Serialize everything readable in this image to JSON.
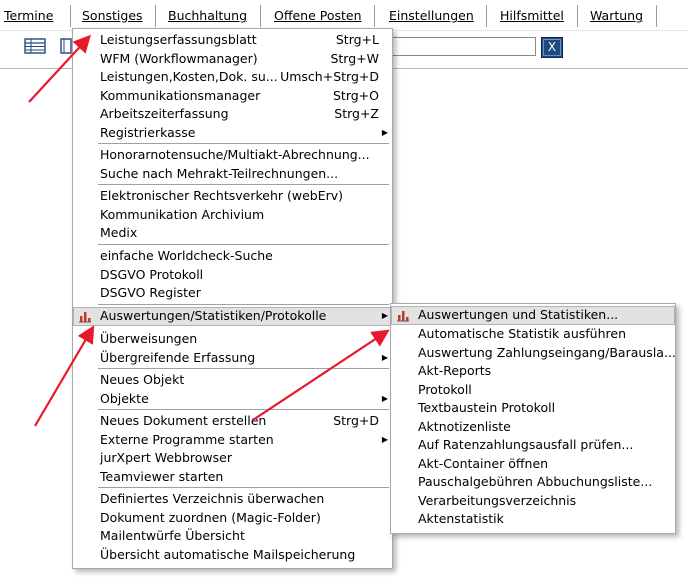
{
  "menubar": {
    "items": [
      {
        "label": "Termine"
      },
      {
        "label": "Sonstiges"
      },
      {
        "label": "Buchhaltung"
      },
      {
        "label": "Offene Posten"
      },
      {
        "label": "Einstellungen"
      },
      {
        "label": "Hilfsmittel"
      },
      {
        "label": "Wartung"
      }
    ]
  },
  "toolbar": {
    "search_value": "",
    "close_label": "X"
  },
  "colors": {
    "accent_arrow": "#e8192c",
    "close_button": "#1f4a80",
    "highlight": "#e2e2e2"
  },
  "main_menu": {
    "items": [
      {
        "label": "Leistungserfassungsblatt",
        "shortcut": "Strg+L"
      },
      {
        "label": "WFM (Workflowmanager)",
        "shortcut": "Strg+W"
      },
      {
        "label": "Leistungen,Kosten,Dok. su...",
        "shortcut": "Umsch+Strg+D"
      },
      {
        "label": "Kommunikationsmanager",
        "shortcut": "Strg+O"
      },
      {
        "label": "Arbeitszeiterfassung",
        "shortcut": "Strg+Z"
      },
      {
        "label": "Registrierkasse",
        "submenu": true
      },
      {
        "label": "Honorarnotensuche/Multiakt-Abrechnung..."
      },
      {
        "label": "Suche nach Mehrakt-Teilrechnungen..."
      },
      {
        "label": "Elektronischer Rechtsverkehr (webErv)"
      },
      {
        "label": "Kommunikation Archivium"
      },
      {
        "label": "Medix"
      },
      {
        "label": "einfache Worldcheck-Suche"
      },
      {
        "label": "DSGVO Protokoll"
      },
      {
        "label": "DSGVO Register"
      },
      {
        "label": "Auswertungen/Statistiken/Protokolle",
        "submenu": true,
        "icon": "bar-chart-icon",
        "highlighted": true
      },
      {
        "label": "Überweisungen"
      },
      {
        "label": "Übergreifende Erfassung",
        "submenu": true
      },
      {
        "label": "Neues Objekt"
      },
      {
        "label": "Objekte",
        "submenu": true
      },
      {
        "label": "Neues Dokument erstellen",
        "shortcut": "Strg+D"
      },
      {
        "label": "Externe Programme starten",
        "submenu": true
      },
      {
        "label": "jurXpert Webbrowser"
      },
      {
        "label": "Teamviewer starten"
      },
      {
        "label": "Definiertes Verzeichnis überwachen"
      },
      {
        "label": "Dokument zuordnen (Magic-Folder)"
      },
      {
        "label": "Mailentwürfe Übersicht"
      },
      {
        "label": "Übersicht automatische Mailspeicherung"
      }
    ]
  },
  "sub_menu": {
    "items": [
      {
        "label": "Auswertungen und Statistiken...",
        "icon": "bar-chart-icon",
        "highlighted": true
      },
      {
        "label": "Automatische Statistik ausführen"
      },
      {
        "label": "Auswertung Zahlungseingang/Barausla..."
      },
      {
        "label": "Akt-Reports"
      },
      {
        "label": "Protokoll"
      },
      {
        "label": "Textbaustein Protokoll"
      },
      {
        "label": "Aktnotizenliste"
      },
      {
        "label": "Auf Ratenzahlungsausfall prüfen..."
      },
      {
        "label": "Akt-Container öffnen"
      },
      {
        "label": "Pauschalgebühren Abbuchungsliste..."
      },
      {
        "label": "Verarbeitungsverzeichnis"
      },
      {
        "label": "Aktenstatistik"
      }
    ]
  }
}
